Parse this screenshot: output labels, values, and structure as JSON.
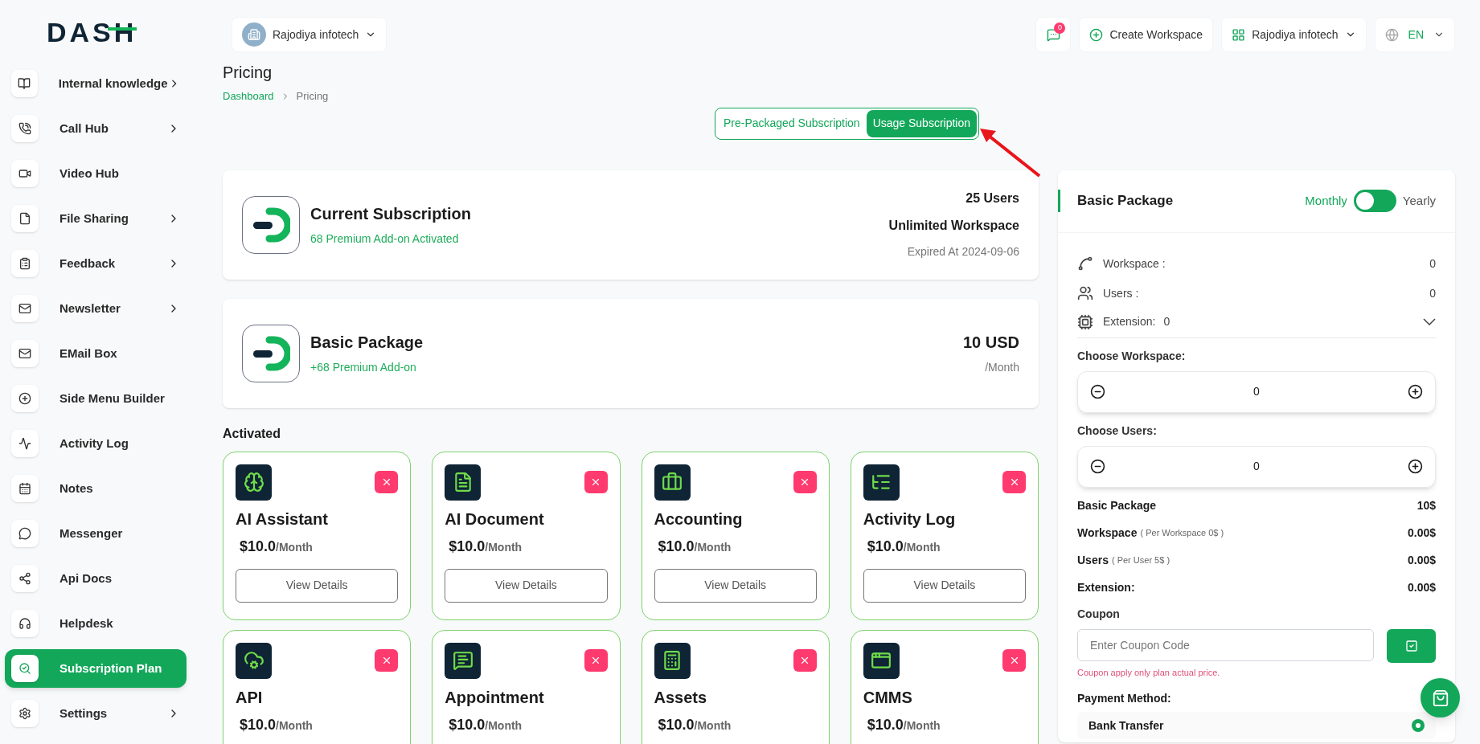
{
  "logo": {
    "text": "DASH"
  },
  "sidebar": {
    "items": [
      {
        "label": "Internal knowledge",
        "expandable": true,
        "selected": false
      },
      {
        "label": "Call Hub",
        "expandable": true,
        "selected": false
      },
      {
        "label": "Video Hub",
        "expandable": false,
        "selected": false
      },
      {
        "label": "File Sharing",
        "expandable": true,
        "selected": false
      },
      {
        "label": "Feedback",
        "expandable": true,
        "selected": false
      },
      {
        "label": "Newsletter",
        "expandable": true,
        "selected": false
      },
      {
        "label": "EMail Box",
        "expandable": false,
        "selected": false
      },
      {
        "label": "Side Menu Builder",
        "expandable": false,
        "selected": false
      },
      {
        "label": "Activity Log",
        "expandable": false,
        "selected": false
      },
      {
        "label": "Notes",
        "expandable": false,
        "selected": false
      },
      {
        "label": "Messenger",
        "expandable": false,
        "selected": false
      },
      {
        "label": "Api Docs",
        "expandable": false,
        "selected": false
      },
      {
        "label": "Helpdesk",
        "expandable": false,
        "selected": false
      },
      {
        "label": "Subscription Plan",
        "expandable": false,
        "selected": true
      },
      {
        "label": "Settings",
        "expandable": true,
        "selected": false
      }
    ]
  },
  "header": {
    "company": "Rajodiya infotech",
    "messages_badge": "0",
    "create_workspace": "Create Workspace",
    "workspace": "Rajodiya infotech",
    "language": "EN"
  },
  "page": {
    "title": "Pricing",
    "breadcrumbs": [
      "Dashboard",
      "Pricing"
    ]
  },
  "subscription_tabs": [
    {
      "label": "Pre-Packaged Subscription",
      "selected": false
    },
    {
      "label": "Usage Subscription",
      "selected": true
    }
  ],
  "current_subscription": {
    "title": "Current Subscription",
    "subtitle": "68 Premium Add-on Activated",
    "users": "25 Users",
    "workspace": "Unlimited Workspace",
    "expiry": "Expired At 2024-09-06"
  },
  "basic_package": {
    "title": "Basic Package",
    "subtitle": "+68 Premium Add-on",
    "price": "10 USD",
    "period": "/Month"
  },
  "activated": {
    "heading": "Activated",
    "addons": [
      {
        "name": "AI Assistant",
        "price": "$10.0",
        "period": "/Month",
        "button": "View Details"
      },
      {
        "name": "AI Document",
        "price": "$10.0",
        "period": "/Month",
        "button": "View Details"
      },
      {
        "name": "Accounting",
        "price": "$10.0",
        "period": "/Month",
        "button": "View Details"
      },
      {
        "name": "Activity Log",
        "price": "$10.0",
        "period": "/Month",
        "button": "View Details"
      },
      {
        "name": "API",
        "price": "$10.0",
        "period": "/Month"
      },
      {
        "name": "Appointment",
        "price": "$10.0",
        "period": "/Month"
      },
      {
        "name": "Assets",
        "price": "$10.0",
        "period": "/Month"
      },
      {
        "name": "CMMS",
        "price": "$10.0",
        "period": "/Month"
      }
    ]
  },
  "order_panel": {
    "title": "Basic Package",
    "billing": [
      {
        "label": "Monthly",
        "selected": true
      },
      {
        "label": "Yearly",
        "selected": false
      }
    ],
    "summary": [
      {
        "label": "Workspace :",
        "value": "0"
      },
      {
        "label": "Users :",
        "value": "0"
      }
    ],
    "extension": {
      "label": "Extension:",
      "value": "0"
    },
    "steppers": [
      {
        "label": "Choose Workspace:",
        "value": "0"
      },
      {
        "label": "Choose Users:",
        "value": "0"
      }
    ],
    "totals": [
      {
        "label": "Basic Package",
        "value": "10$"
      },
      {
        "label": "Workspace",
        "note": "( Per Workspace 0$ )",
        "value": "0.00$"
      },
      {
        "label": "Users",
        "note": "( Per User 5$ )",
        "value": "0.00$"
      },
      {
        "label": "Extension:",
        "value": "0.00$"
      }
    ],
    "coupon": {
      "label": "Coupon",
      "placeholder": "Enter Coupon Code",
      "hint": "Coupon apply only plan actual price."
    },
    "payment": {
      "label": "Payment Method:",
      "methods": [
        {
          "label": "Bank Transfer",
          "selected": true
        }
      ]
    }
  }
}
